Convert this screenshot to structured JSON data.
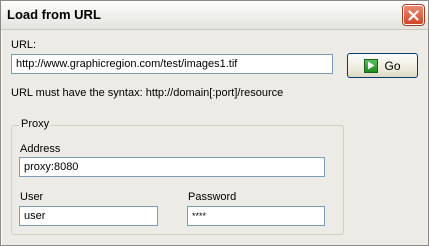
{
  "window": {
    "title": "Load from URL"
  },
  "url": {
    "label": "URL:",
    "value": "http://www.graphicregion.com/test/images1.tif",
    "hint": "URL must have the syntax: http://domain[:port]/resource"
  },
  "go_button": {
    "label": "Go"
  },
  "proxy": {
    "legend": "Proxy",
    "address_label": "Address",
    "address_value": "proxy:8080",
    "user_label": "User",
    "user_value": "user",
    "password_label": "Password",
    "password_value": "****"
  },
  "icons": {
    "close": "close-icon",
    "go": "play-arrow-icon"
  },
  "colors": {
    "close_button": "#d2462a",
    "go_icon": "#2f9e32"
  }
}
